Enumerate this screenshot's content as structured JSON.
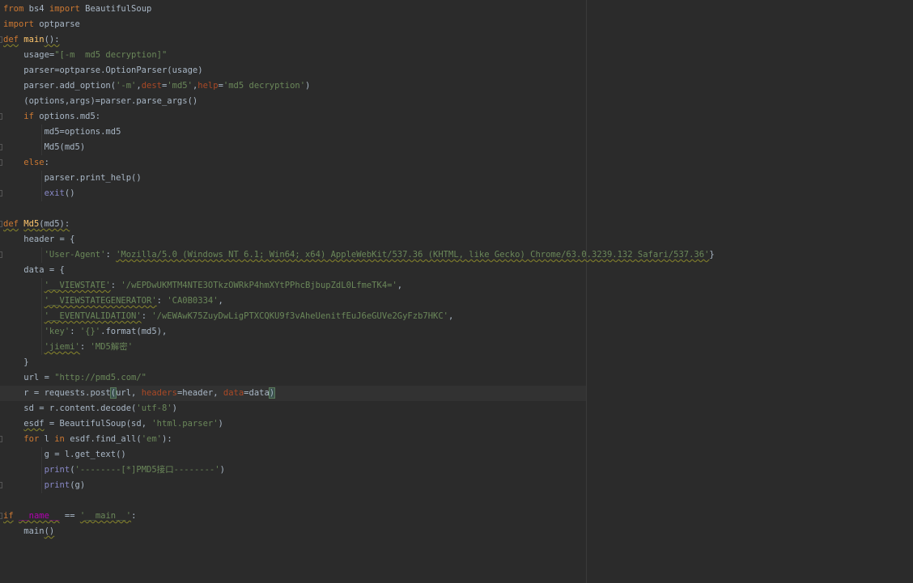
{
  "editor": {
    "lines": [
      [
        {
          "t": "from",
          "c": "kw"
        },
        {
          "t": " bs4 "
        },
        {
          "t": "import",
          "c": "kw"
        },
        {
          "t": " BeautifulSoup"
        }
      ],
      [
        {
          "t": "import",
          "c": "kw"
        },
        {
          "t": " optparse"
        }
      ],
      [
        {
          "t": "def",
          "c": "kw warn"
        },
        {
          "t": " "
        },
        {
          "t": "main",
          "c": "fn"
        },
        {
          "t": "():",
          "c": "warn"
        }
      ],
      [
        {
          "t": "    usage="
        },
        {
          "t": "\"[-m  md5 decryption]\"",
          "c": "str"
        }
      ],
      [
        {
          "t": "    parser=optparse.OptionParser(usage)"
        }
      ],
      [
        {
          "t": "    parser.add_option("
        },
        {
          "t": "'-m'",
          "c": "str"
        },
        {
          "t": ","
        },
        {
          "t": "dest",
          "c": "param"
        },
        {
          "t": "="
        },
        {
          "t": "'md5'",
          "c": "str"
        },
        {
          "t": ","
        },
        {
          "t": "help",
          "c": "param"
        },
        {
          "t": "="
        },
        {
          "t": "'md5 decryption'",
          "c": "str"
        },
        {
          "t": ")"
        }
      ],
      [
        {
          "t": "    (options,args)=parser.parse_args()"
        }
      ],
      [
        {
          "t": "    "
        },
        {
          "t": "if",
          "c": "kw"
        },
        {
          "t": " options.md5:"
        }
      ],
      [
        {
          "t": "        md5=options.md5"
        }
      ],
      [
        {
          "t": "        Md5(md5)"
        }
      ],
      [
        {
          "t": "    "
        },
        {
          "t": "else",
          "c": "kw"
        },
        {
          "t": ":"
        }
      ],
      [
        {
          "t": "        parser.print_help()"
        }
      ],
      [
        {
          "t": "        "
        },
        {
          "t": "exit",
          "c": "builtin"
        },
        {
          "t": "()"
        }
      ],
      [],
      [
        {
          "t": "def",
          "c": "kw warn"
        },
        {
          "t": " "
        },
        {
          "t": "Md5",
          "c": "fn warn"
        },
        {
          "t": "(md5):",
          "c": "warn"
        }
      ],
      [
        {
          "t": "    header = {"
        }
      ],
      [
        {
          "t": "        "
        },
        {
          "t": "'User-Agent'",
          "c": "str"
        },
        {
          "t": ": "
        },
        {
          "t": "'Mozilla/5.0 (Windows NT 6.1; Win64; x64) AppleWebKit/537.36 (KHTML, like Gecko) Chrome/63.0.3239.132 Safari/537.36'",
          "c": "str warn"
        },
        {
          "t": "}"
        }
      ],
      [
        {
          "t": "    data = {"
        }
      ],
      [
        {
          "t": "        "
        },
        {
          "t": "'__VIEWSTATE'",
          "c": "str warn"
        },
        {
          "t": ": "
        },
        {
          "t": "'/wEPDwUKMTM4NTE3OTkzOWRkP4hmXYtPPhcBjbupZdL0LfmeTK4='",
          "c": "str"
        },
        {
          "t": ","
        }
      ],
      [
        {
          "t": "        "
        },
        {
          "t": "'__VIEWSTATEGENERATOR'",
          "c": "str warn"
        },
        {
          "t": ": "
        },
        {
          "t": "'CA0B0334'",
          "c": "str"
        },
        {
          "t": ","
        }
      ],
      [
        {
          "t": "        "
        },
        {
          "t": "'__EVENTVALIDATION'",
          "c": "str warn"
        },
        {
          "t": ": "
        },
        {
          "t": "'/wEWAwK75ZuyDwLigPTXCQKU9f3vAheUenitfEuJ6eGUVe2GyFzb7HKC'",
          "c": "str"
        },
        {
          "t": ","
        }
      ],
      [
        {
          "t": "        "
        },
        {
          "t": "'key'",
          "c": "str"
        },
        {
          "t": ": "
        },
        {
          "t": "'{}'",
          "c": "str"
        },
        {
          "t": ".format(md5),"
        }
      ],
      [
        {
          "t": "        "
        },
        {
          "t": "'jiemi'",
          "c": "str warn"
        },
        {
          "t": ": "
        },
        {
          "t": "'MD5解密'",
          "c": "str"
        }
      ],
      [
        {
          "t": "    }"
        }
      ],
      [
        {
          "t": "    url = "
        },
        {
          "t": "\"http://pmd5.com/\"",
          "c": "str"
        }
      ],
      [
        {
          "t": "    r = requests.post"
        },
        {
          "t": "(",
          "c": "brace"
        },
        {
          "t": "url, "
        },
        {
          "t": "headers",
          "c": "param"
        },
        {
          "t": "=header, "
        },
        {
          "t": "data",
          "c": "param"
        },
        {
          "t": "=data"
        },
        {
          "t": ")",
          "c": "brace"
        }
      ],
      [
        {
          "t": "    sd = r.content.decode("
        },
        {
          "t": "'utf-8'",
          "c": "str"
        },
        {
          "t": ")"
        }
      ],
      [
        {
          "t": "    "
        },
        {
          "t": "esdf",
          "c": "warn"
        },
        {
          "t": " = BeautifulSoup(sd, "
        },
        {
          "t": "'html.parser'",
          "c": "str"
        },
        {
          "t": ")"
        }
      ],
      [
        {
          "t": "    "
        },
        {
          "t": "for",
          "c": "kw"
        },
        {
          "t": " l "
        },
        {
          "t": "in",
          "c": "kw"
        },
        {
          "t": " esdf.find_all("
        },
        {
          "t": "'em'",
          "c": "str"
        },
        {
          "t": "):"
        }
      ],
      [
        {
          "t": "        g = l.get_text()"
        }
      ],
      [
        {
          "t": "        "
        },
        {
          "t": "print",
          "c": "builtin"
        },
        {
          "t": "("
        },
        {
          "t": "'--------[*]PMD5接口--------'",
          "c": "str"
        },
        {
          "t": ")"
        }
      ],
      [
        {
          "t": "        "
        },
        {
          "t": "print",
          "c": "builtin"
        },
        {
          "t": "(g)"
        }
      ],
      [],
      [
        {
          "t": "if",
          "c": "kw warn"
        },
        {
          "t": " "
        },
        {
          "t": "__name__",
          "c": "magic warn"
        },
        {
          "t": " == "
        },
        {
          "t": "'__main__'",
          "c": "str warn"
        },
        {
          "t": ":"
        }
      ],
      [
        {
          "t": "    main"
        },
        {
          "t": "()",
          "c": "warn"
        }
      ]
    ],
    "fold_markers": [
      2,
      7,
      9,
      10,
      12,
      14,
      16,
      28,
      31,
      33
    ],
    "current_line": 25
  }
}
